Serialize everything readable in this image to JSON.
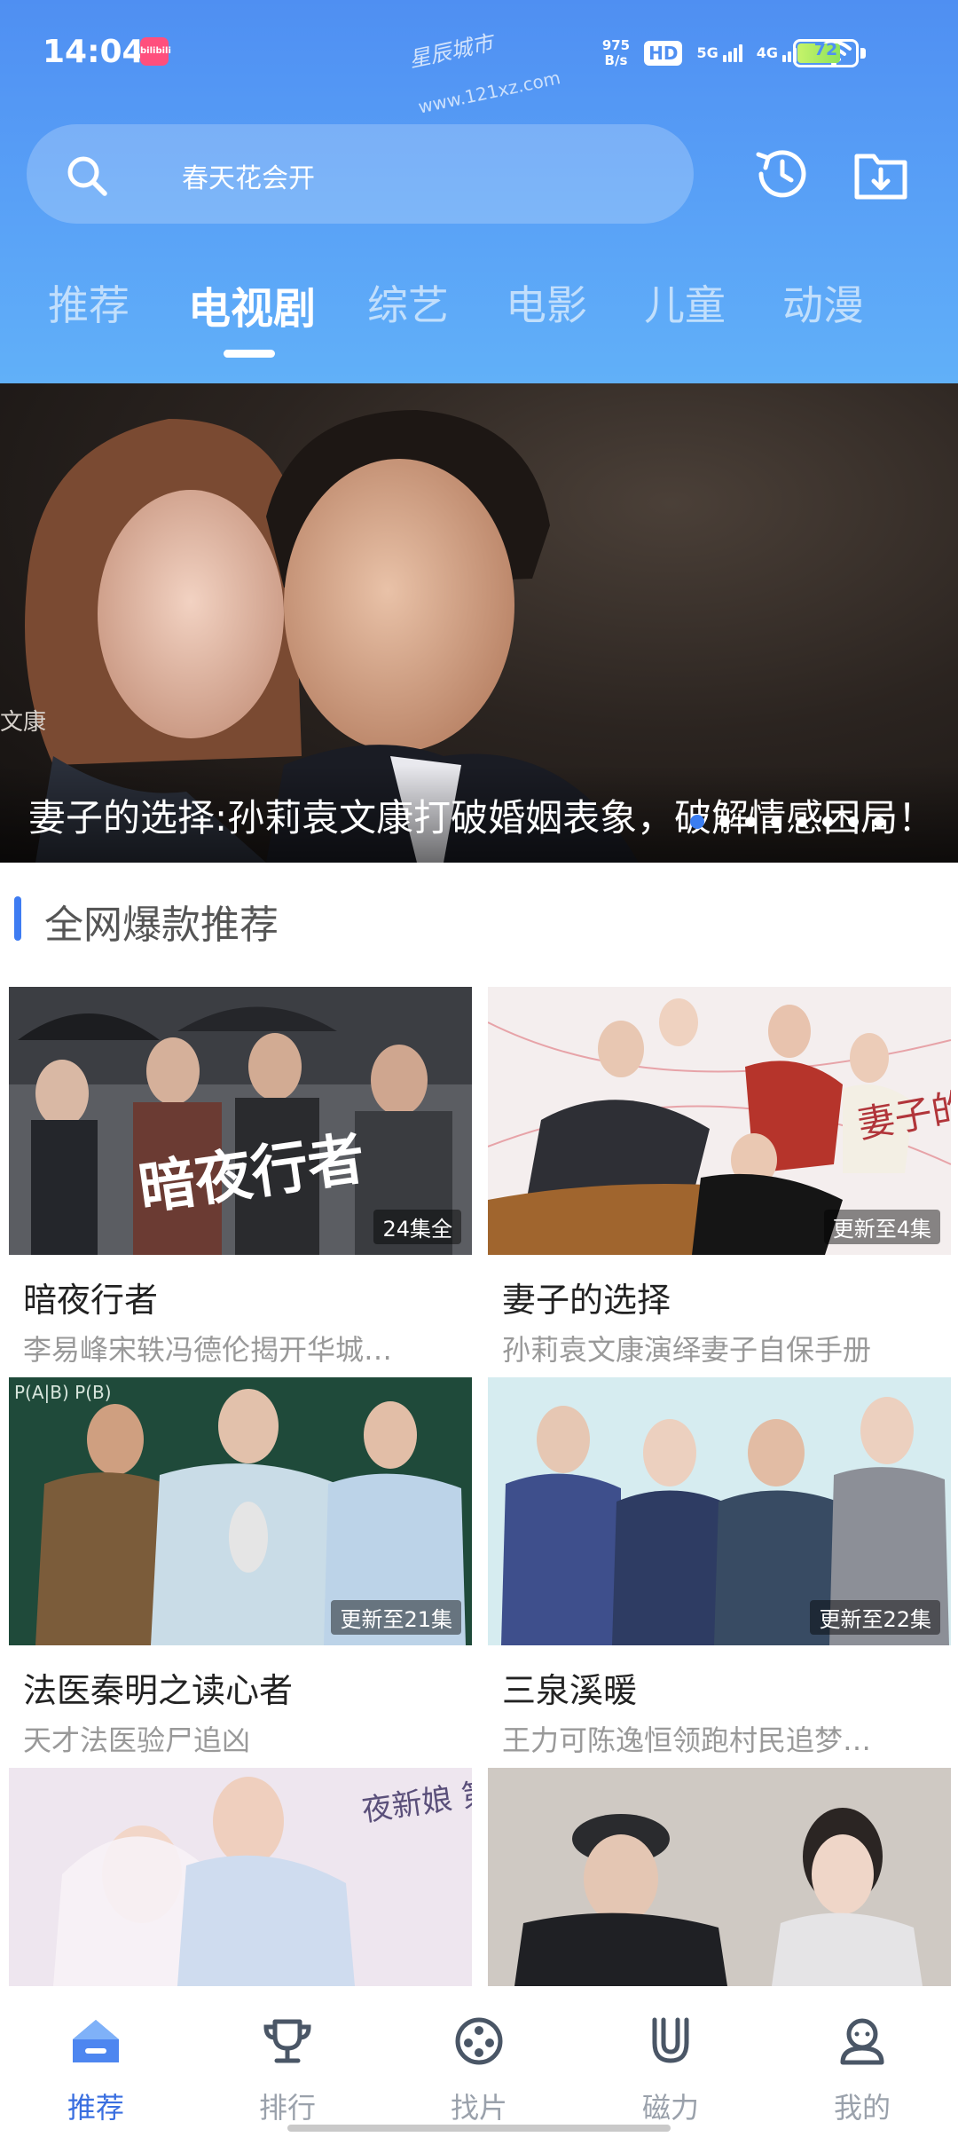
{
  "status_bar": {
    "time": "14:04",
    "app_badge": "bilibili",
    "speed_value": "975",
    "speed_unit": "B/s",
    "hd": "HD",
    "network_1": "5G",
    "network_2": "4G",
    "battery": "72",
    "watermark": "星辰城市",
    "watermark_url": "www.121xz.com"
  },
  "search": {
    "placeholder": "春天花会开",
    "icon": "search-icon"
  },
  "header_icons": [
    "history-icon",
    "download-icon"
  ],
  "tabs": [
    {
      "label": "推荐",
      "active": false
    },
    {
      "label": "电视剧",
      "active": true
    },
    {
      "label": "综艺",
      "active": false
    },
    {
      "label": "电影",
      "active": false
    },
    {
      "label": "儿童",
      "active": false
    },
    {
      "label": "动漫",
      "active": false
    }
  ],
  "banner": {
    "title": "妻子的选择:孙莉袁文康打破婚姻表象，破解情感困局！",
    "side_text": "文康",
    "dot_count": 8,
    "active_dot": 0
  },
  "section": {
    "title": "全网爆款推荐"
  },
  "cards": [
    {
      "title": "暗夜行者",
      "subtitle": "李易峰宋轶冯德伦揭开华城…",
      "badge": "24集全",
      "poster_text": "暗夜行者"
    },
    {
      "title": "妻子的选择",
      "subtitle": "孙莉袁文康演绎妻子自保手册",
      "badge": "更新至4集",
      "poster_text": "妻子的选择"
    },
    {
      "title": "法医秦明之读心者",
      "subtitle": "天才法医验尸追凶",
      "badge": "更新至21集",
      "poster_text": "P(A|B)  P(B)"
    },
    {
      "title": "三泉溪暖",
      "subtitle": "王力可陈逸恒领跑村民追梦…",
      "badge": "更新至22集",
      "poster_text": ""
    },
    {
      "title": "",
      "subtitle": "",
      "badge": "",
      "poster_text": "夜新娘 第二季"
    },
    {
      "title": "",
      "subtitle": "",
      "badge": "",
      "poster_text": ""
    }
  ],
  "bottom_nav": [
    {
      "label": "推荐",
      "icon": "home-icon",
      "active": true
    },
    {
      "label": "排行",
      "icon": "trophy-icon",
      "active": false
    },
    {
      "label": "找片",
      "icon": "film-reel-icon",
      "active": false
    },
    {
      "label": "磁力",
      "icon": "magnet-icon",
      "active": false
    },
    {
      "label": "我的",
      "icon": "profile-icon",
      "active": false
    }
  ],
  "colors": {
    "header_gradient_top": "#4f8ff2",
    "header_gradient_bottom": "#61b0f8",
    "accent": "#3a6fe0",
    "inactive_nav": "#9aa1ab"
  }
}
